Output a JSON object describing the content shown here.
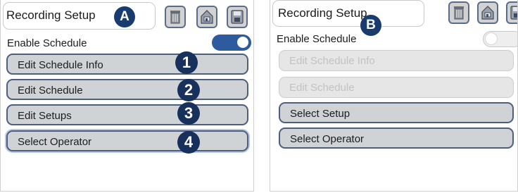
{
  "colors": {
    "badge_navy": "#17305c",
    "button_border": "#4e5f7d",
    "button_fill": "#cfd3d6",
    "disabled_fill": "#e6e6e6",
    "toggle_on": "#2e5a9e"
  },
  "panel_a": {
    "title": "Recording Setup",
    "badge": "A",
    "enable_label": "Enable Schedule",
    "toggle_state": "on",
    "buttons": [
      {
        "label": "Edit Schedule Info",
        "state": "enabled",
        "number": "1"
      },
      {
        "label": "Edit Schedule",
        "state": "enabled",
        "number": "2"
      },
      {
        "label": "Edit Setups",
        "state": "enabled",
        "number": "3"
      },
      {
        "label": "Select Operator",
        "state": "selected",
        "number": "4"
      }
    ]
  },
  "panel_b": {
    "title": "Recording Setup",
    "badge": "B",
    "enable_label": "Enable Schedule",
    "toggle_state": "off",
    "buttons": [
      {
        "label": "Edit Schedule Info",
        "state": "disabled"
      },
      {
        "label": "Edit Schedule",
        "state": "disabled"
      },
      {
        "label": "Select Setup",
        "state": "enabled"
      },
      {
        "label": "Select Operator",
        "state": "enabled"
      }
    ]
  },
  "icons": {
    "trash": "trash-icon",
    "load": "load-schedule-icon",
    "save": "save-schedule-icon"
  }
}
